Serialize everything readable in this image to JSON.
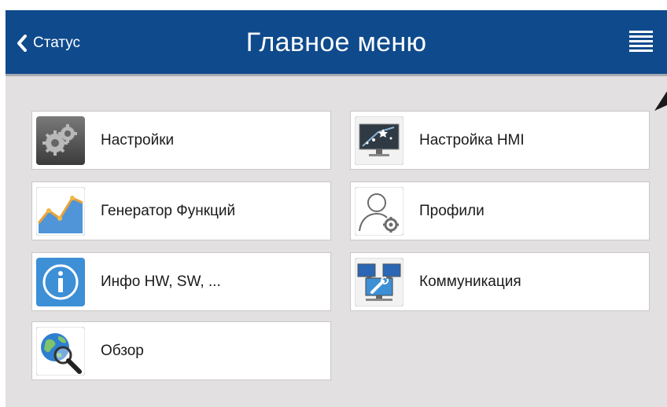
{
  "header": {
    "back_label": "Статус",
    "title": "Главное меню",
    "menu_icon": "hamburger-icon",
    "background_color": "#0f4a8c"
  },
  "menu": {
    "items": [
      {
        "label": "Настройки",
        "icon": "gears-icon"
      },
      {
        "label": "Настройка HMI",
        "icon": "monitor-stars-icon"
      },
      {
        "label": "Генератор Функций",
        "icon": "graph-icon"
      },
      {
        "label": "Профили",
        "icon": "user-gear-icon"
      },
      {
        "label": "Инфо HW, SW, ...",
        "icon": "info-icon"
      },
      {
        "label": "Коммуникация",
        "icon": "network-computers-icon"
      },
      {
        "label": "Обзор",
        "icon": "globe-magnifier-icon"
      }
    ]
  }
}
